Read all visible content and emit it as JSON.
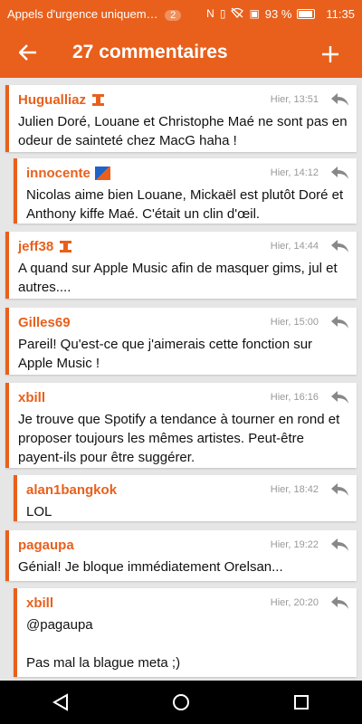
{
  "status": {
    "notification": "Appels d'urgence uniquem…",
    "badge": "2",
    "battery": "93 %",
    "time": "11:35"
  },
  "header": {
    "title": "27 commentaires"
  },
  "colors": {
    "accent": "#e8601c"
  },
  "comments": [
    {
      "user": "Hugualliaz",
      "time": "Hier, 13:51",
      "text": "Julien Doré, Louane et Christophe Maé ne sont pas en odeur de sainteté chez MacG haha !"
    },
    {
      "user": "innocente",
      "time": "Hier, 14:12",
      "text": "Nicolas aime bien Louane, Mickaël est plutôt Doré et Anthony kiffe Maé. C'était un clin d'œil."
    },
    {
      "user": "jeff38",
      "time": "Hier, 14:44",
      "text": "A quand sur Apple Music afin de masquer gims, jul et autres...."
    },
    {
      "user": "Gilles69",
      "time": "Hier, 15:00",
      "text": "Pareil! Qu'est-ce que j'aimerais cette fonction sur Apple Music !"
    },
    {
      "user": "xbill",
      "time": "Hier, 16:16",
      "text": "Je trouve que Spotify a tendance à tourner en rond et proposer toujours les mêmes artistes. Peut-être payent-ils pour être suggérer."
    },
    {
      "user": "alan1bangkok",
      "time": "Hier, 18:42",
      "text": "LOL"
    },
    {
      "user": "pagaupa",
      "time": "Hier, 19:22",
      "text": "Génial! Je bloque immédiatement Orelsan..."
    },
    {
      "user": "xbill",
      "time": "Hier, 20:20",
      "text": "@pagaupa\n\nPas mal la blague meta ;)"
    }
  ]
}
